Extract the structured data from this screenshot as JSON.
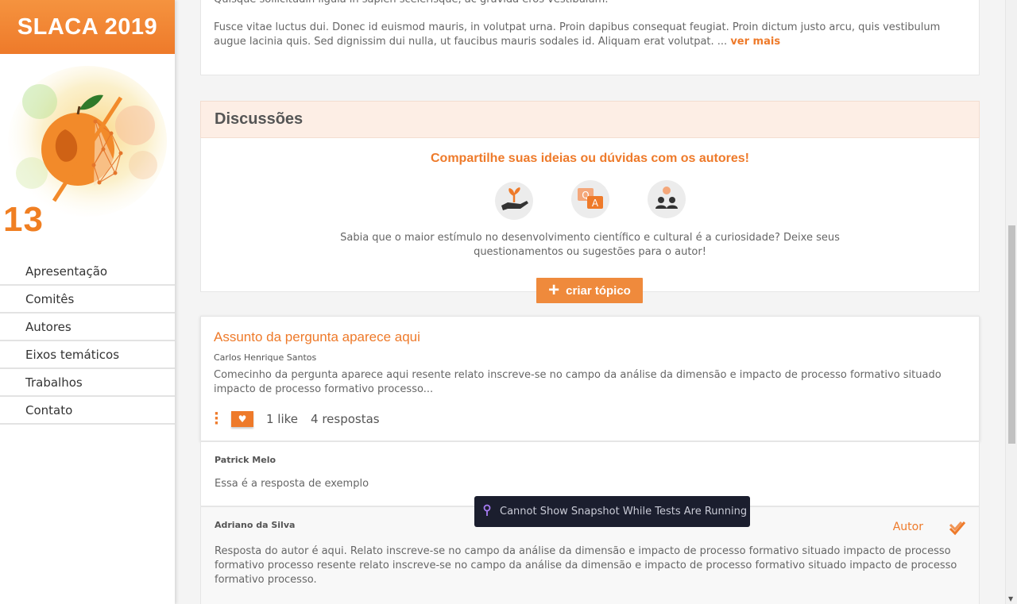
{
  "brand": {
    "title": "SLACA 2019",
    "logo_text": "13 SLACA"
  },
  "nav": {
    "items": [
      {
        "label": "Apresentação"
      },
      {
        "label": "Comitês"
      },
      {
        "label": "Autores"
      },
      {
        "label": "Eixos temáticos"
      },
      {
        "label": "Trabalhos"
      },
      {
        "label": "Contato"
      }
    ]
  },
  "summary": {
    "line1": "Quisque sollicitudin ligula in sapien scelerisque, ac gravida eros vestibulum.",
    "para2": "Fusce vitae luctus dui. Donec id euismod mauris, in volutpat urna. Proin dapibus consequat feugiat. Proin dictum justo arcu, quis vestibulum augue lacinia quis. Sed dignissim dui nulla, ut faucibus mauris sodales id. Aliquam erat volutpat. ... ",
    "read_more": "ver mais"
  },
  "discussions": {
    "title": "Discussões",
    "share_title": "Compartilhe suas ideias ou dúvidas com os autores!",
    "description": "Sabia que o maior estímulo no desenvolvimento científico e cultural é a curiosidade? Deixe seus questionamentos ou sugestões para o autor!",
    "create_label": "criar tópico"
  },
  "topic": {
    "title": "Assunto da pergunta aparece aqui",
    "author": "Carlos Henrique Santos",
    "text": "Comecinho da pergunta aparece aqui resente relato inscreve-se no campo da análise da dimensão e impacto de processo formativo situado impacto de processo formativo processo...",
    "likes": "1 like",
    "replies_count": "4 respostas"
  },
  "replies": [
    {
      "author": "Patrick Melo",
      "text": "Essa é a resposta de exemplo"
    },
    {
      "author": "Adriano da Silva",
      "badge": "Autor",
      "text": "Resposta do autor é aqui. Relato inscreve-se no campo da análise da dimensão e impacto de processo formativo situado impacto de processo formativo processo resente relato inscreve-se no campo da análise da dimensão e impacto de processo formativo situado impacto de processo formativo processo."
    }
  ],
  "tooltip": {
    "text": "Cannot Show Snapshot While Tests Are Running"
  },
  "colors": {
    "accent": "#ee7a2a",
    "header_bg": "#fdeee5",
    "tooltip_bg": "#1b1e2e"
  }
}
